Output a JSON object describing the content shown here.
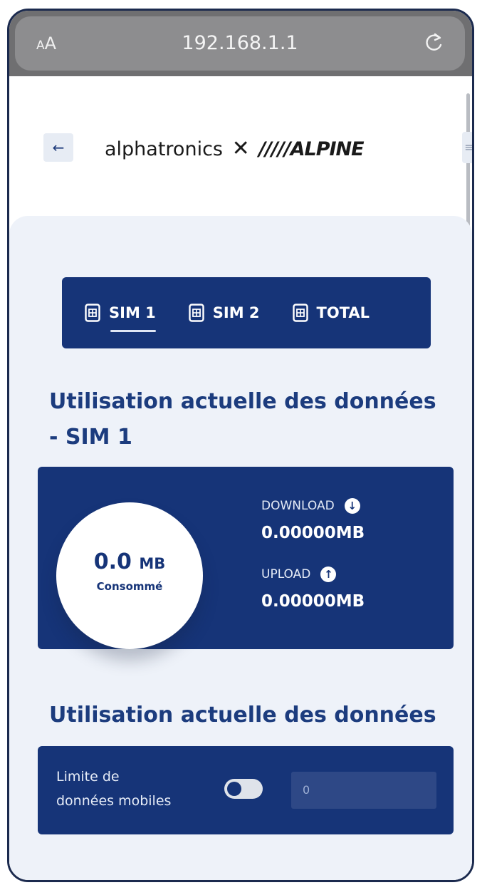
{
  "browser": {
    "aa_small": "A",
    "aa_large": "A",
    "url": "192.168.1.1"
  },
  "header": {
    "back_symbol": "←",
    "logo_left": "alphatronics",
    "logo_x": "✕",
    "logo_right": "/////ALPINE",
    "menu_symbol": "≡"
  },
  "tabs": [
    {
      "label": "SIM 1",
      "active": true
    },
    {
      "label": "SIM 2",
      "active": false
    },
    {
      "label": "TOTAL",
      "active": false
    }
  ],
  "usage": {
    "title_line1": "Utilisation actuelle des données",
    "title_line2": "- SIM 1",
    "consumed_value": "0.0",
    "consumed_unit": "MB",
    "consumed_label": "Consommé",
    "download_label": "DOWNLOAD",
    "download_value": "0.00000MB",
    "upload_label": "UPLOAD",
    "upload_value": "0.00000MB"
  },
  "limit": {
    "title": "Utilisation actuelle des données",
    "label_line1": "Limite de",
    "label_line2": "données mobiles",
    "toggle_on": false,
    "input_value": "0"
  },
  "colors": {
    "primary": "#163478",
    "title": "#1c3c7e",
    "background": "#eef2f9"
  }
}
